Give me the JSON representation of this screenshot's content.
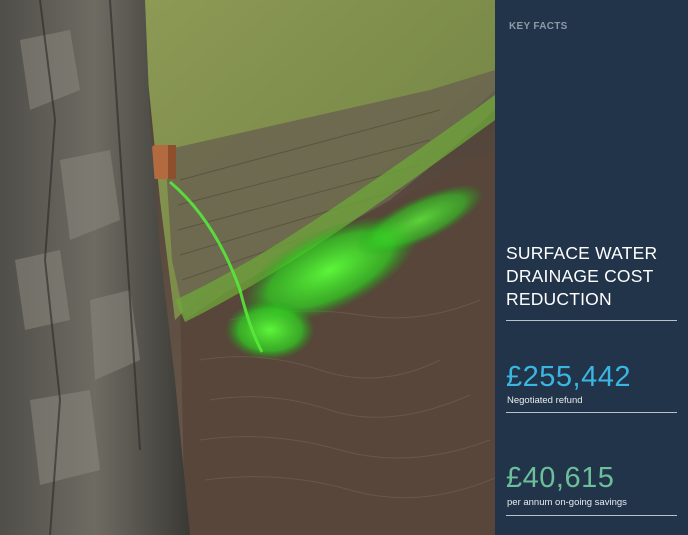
{
  "panel": {
    "kicker": "KEY FACTS",
    "title": "SURFACE WATER DRAINAGE COST REDUCTION",
    "stat1": {
      "value": "£255,442",
      "label": "Negotiated refund"
    },
    "stat2": {
      "value": "£40,615",
      "label": "per annum on-going savings"
    }
  },
  "colors": {
    "panel_bg": "#22344a",
    "accent_blue": "#3ab6e2",
    "accent_green": "#6bbf9a"
  }
}
